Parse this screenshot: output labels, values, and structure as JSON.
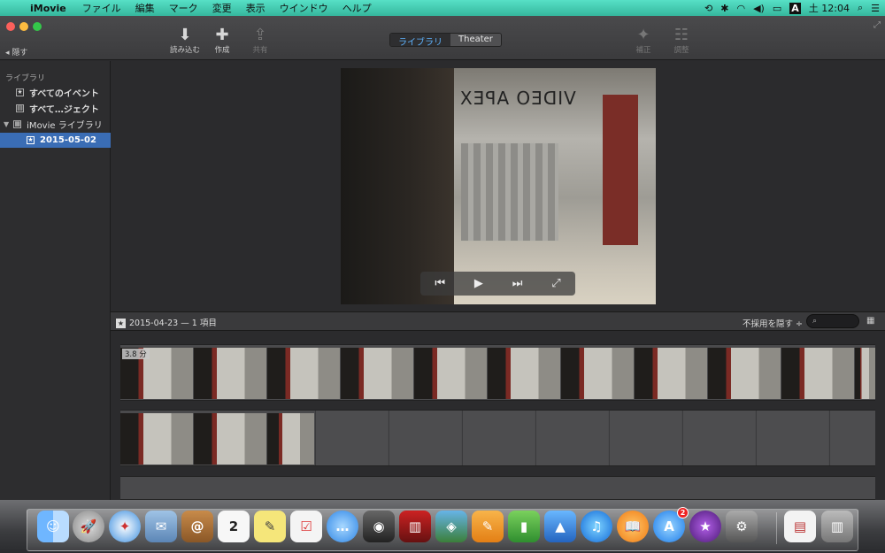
{
  "menubar": {
    "app_name": "iMovie",
    "menus": [
      "ファイル",
      "編集",
      "マーク",
      "変更",
      "表示",
      "ウインドウ",
      "ヘルプ"
    ],
    "clock": "土 12:04",
    "input_indicator": "A"
  },
  "toolbar": {
    "hide_label": "隠す",
    "import_label": "読み込む",
    "create_label": "作成",
    "share_label": "共有",
    "enhance_label": "補正",
    "adjust_label": "調整",
    "library_tab": "ライブラリ",
    "theater_tab": "Theater"
  },
  "sidebar": {
    "header": "ライブラリ",
    "items": [
      {
        "label": "すべてのイベント"
      },
      {
        "label": "すべて…ジェクト"
      },
      {
        "label": "iMovie ライブラリ"
      },
      {
        "label": "2015-05-02"
      }
    ]
  },
  "viewer": {
    "sign_text": "VIDEO APEX"
  },
  "browser": {
    "event_date": "2015-04-23 — 1 項目",
    "hide_rejected": "不採用を隠す ÷",
    "search_placeholder": "",
    "clip_duration": "3.8 分"
  },
  "dock": {
    "badge_count": "2",
    "apps": [
      "Finder",
      "Launchpad",
      "Safari",
      "Mail",
      "Contacts",
      "Calendar",
      "Notes",
      "Reminders",
      "Messages",
      "FaceTime",
      "Photo Booth",
      "iPhoto",
      "Pages",
      "Numbers",
      "Keynote",
      "iTunes",
      "iBooks",
      "App Store",
      "iMovie",
      "System Preferences",
      "Document",
      "Trash"
    ]
  }
}
